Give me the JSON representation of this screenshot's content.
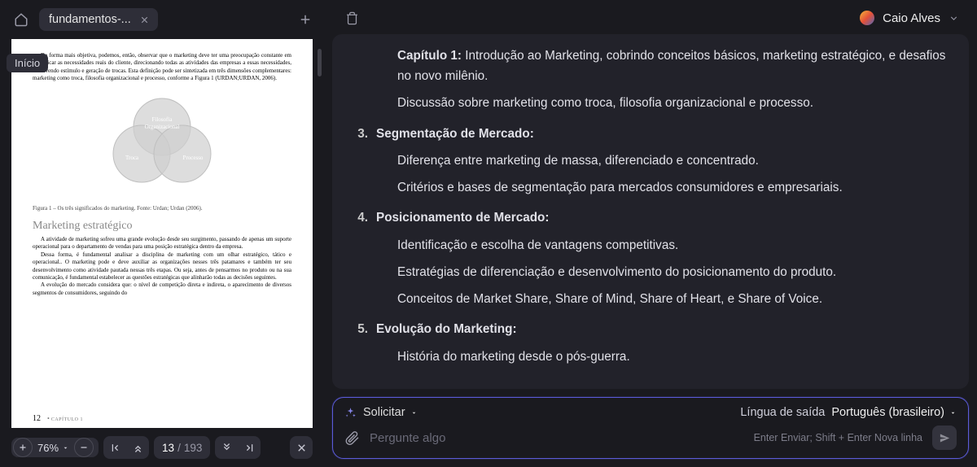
{
  "left": {
    "tab_label": "fundamentos-...",
    "tooltip": "Início",
    "zoom": "76%",
    "page_current": "13",
    "page_sep": "/",
    "page_total": "193"
  },
  "doc": {
    "para1": "De forma mais objetiva, podemos, então, observar que o marketing deve ter uma preocupação constante em identificar as necessidades reais do cliente, direcionando todas as atividades das empresas a essas necessidades, envolvendo estímulo e geração de trocas. Esta definição pode ser sintetizada em três dimensões complementares: marketing como troca, filosofia organizacional e processo, conforme a Figura 1 (URDAN;URDAN, 2006).",
    "venn_top1": "Filosofia",
    "venn_top2": "Organizacional",
    "venn_left": "Troca",
    "venn_right": "Processo",
    "fig_caption": "Figura 1 – Os três significados do marketing. Fonte: Urdan; Urdan (2006).",
    "section_h": "Marketing estratégico",
    "para2": "A atividade de marketing sofreu uma grande evolução desde seu surgimento, passando de apenas um suporte operacional para o departamento de vendas para uma posição estratégica dentro da empresa.",
    "para3": "Dessa forma, é fundamental analisar a disciplina de marketing com um olhar estratégico, tático e operacional.. O marketing pode e deve auxiliar as organizações nesses três patamares e também ter seu desenvolvimento como atividade pautada nessas três etapas. Ou seja, antes de pensarmos no produto ou na sua comunicação, é fundamental estabelecer as questões estratégicas que alinharão todas as decisões seguintes.",
    "para4": "A evolução do mercado considera que: o nível de competição direta e indireta, o aparecimento de diversos segmentos de consumidores, seguindo do",
    "page_num": "12",
    "page_chapter": "CAPÍTULO 1"
  },
  "right_header": {
    "user_name": "Caio Alves"
  },
  "content": {
    "cap_label": "Capítulo 1:",
    "cap_text": " Introdução ao Marketing, cobrindo conceitos básicos, marketing estratégico, e desafios no novo milênio.",
    "cap_sub1": "Discussão sobre marketing como troca, filosofia organizacional e processo.",
    "items": [
      {
        "num": "3.",
        "head": "Segmentação de Mercado:",
        "body": [
          "Diferença entre marketing de massa, diferenciado e concentrado.",
          "Critérios e bases de segmentação para mercados consumidores e empresariais."
        ]
      },
      {
        "num": "4.",
        "head": "Posicionamento de Mercado:",
        "body": [
          "Identificação e escolha de vantagens competitivas.",
          "Estratégias de diferenciação e desenvolvimento do posicionamento do produto.",
          "Conceitos de Market Share, Share of Mind, Share of Heart, e Share of Voice."
        ]
      },
      {
        "num": "5.",
        "head": "Evolução do Marketing:",
        "body": [
          "História do marketing desde o pós-guerra."
        ]
      }
    ]
  },
  "dock": {
    "solicitar": "Solicitar",
    "lang_label": "Língua de saída",
    "lang_value": "Português (brasileiro)",
    "placeholder": "Pergunte algo",
    "hint": "Enter Enviar; Shift + Enter Nova linha"
  }
}
